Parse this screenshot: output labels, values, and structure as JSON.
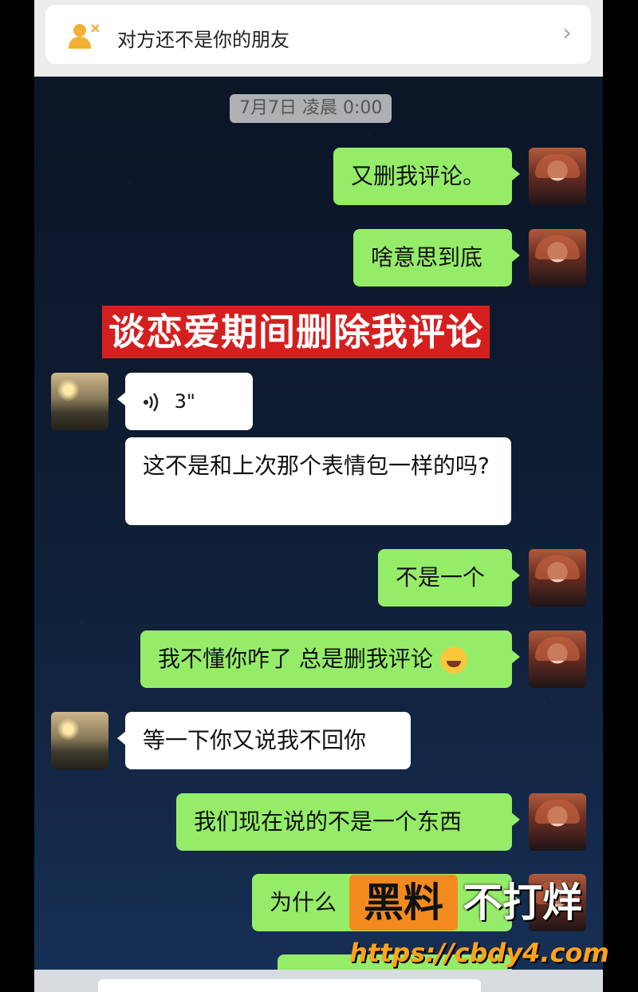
{
  "banner": {
    "icon": "add-friend-icon",
    "text": "对方还不是你的朋友",
    "chevron": "›"
  },
  "timestamp": "7月7日 凌晨 0:00",
  "overlay_caption": "谈恋爱期间删除我评论",
  "messages": [
    {
      "side": "me",
      "type": "text",
      "text": "又删我评论。"
    },
    {
      "side": "me",
      "type": "text",
      "text": "啥意思到底"
    },
    {
      "side": "other",
      "type": "voice",
      "duration": "3\""
    },
    {
      "side": "other",
      "type": "text",
      "text": "这不是和上次那个表情包一样的吗?"
    },
    {
      "side": "me",
      "type": "text",
      "text": "不是一个"
    },
    {
      "side": "me",
      "type": "text",
      "text": "我不懂你咋了 总是删我评论",
      "emoji": "tears-of-joy-emoji"
    },
    {
      "side": "other",
      "type": "text",
      "text": "等一下你又说我不回你"
    },
    {
      "side": "me",
      "type": "text",
      "text": "我们现在说的不是一个东西"
    },
    {
      "side": "me",
      "type": "text",
      "text": "为什么"
    }
  ],
  "watermark": {
    "box_text": "黑料",
    "right_text": "不打烊",
    "url": "https://cbdy4.com",
    "box_color": "#f28a1e"
  },
  "colors": {
    "bubble_me": "#95ec69",
    "bubble_other": "#ffffff",
    "caption_bg": "#d51f1f"
  }
}
